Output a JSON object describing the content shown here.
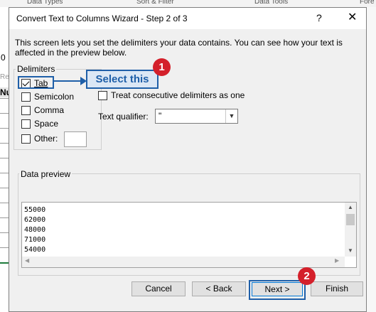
{
  "background": {
    "ribbon_items": [
      "Data Types",
      "Sort & Filter",
      "Data Tools",
      "Fore"
    ],
    "column_header_fragment": "Nu",
    "row_fragment": "Re",
    "left_fragment": "0"
  },
  "dialog": {
    "title": "Convert Text to Columns Wizard - Step 2 of 3",
    "help": "?",
    "close": "✕",
    "description": "This screen lets you set the delimiters your data contains.  You can see how your text is affected in the preview below."
  },
  "delimiters": {
    "group_label": "Delimiters",
    "options": [
      {
        "label": "Tab",
        "checked": true
      },
      {
        "label": "Semicolon",
        "checked": false
      },
      {
        "label": "Comma",
        "checked": false
      },
      {
        "label": "Space",
        "checked": false
      },
      {
        "label": "Other:",
        "checked": false
      }
    ],
    "other_value": ""
  },
  "consecutive": {
    "label": "Treat consecutive delimiters as one",
    "checked": false
  },
  "qualifier": {
    "label": "Text qualifier:",
    "value": "\""
  },
  "preview": {
    "label": "Data preview",
    "lines": [
      "55000",
      "62000",
      "48000",
      "71000",
      "54000"
    ]
  },
  "buttons": {
    "cancel": "Cancel",
    "back": "< Back",
    "next": "Next >",
    "finish": "Finish"
  },
  "annotations": {
    "callout_text": "Select this",
    "badge_1": "1",
    "badge_2": "2",
    "highlight_color": "#1f5fa8",
    "badge_color": "#d4202b"
  }
}
